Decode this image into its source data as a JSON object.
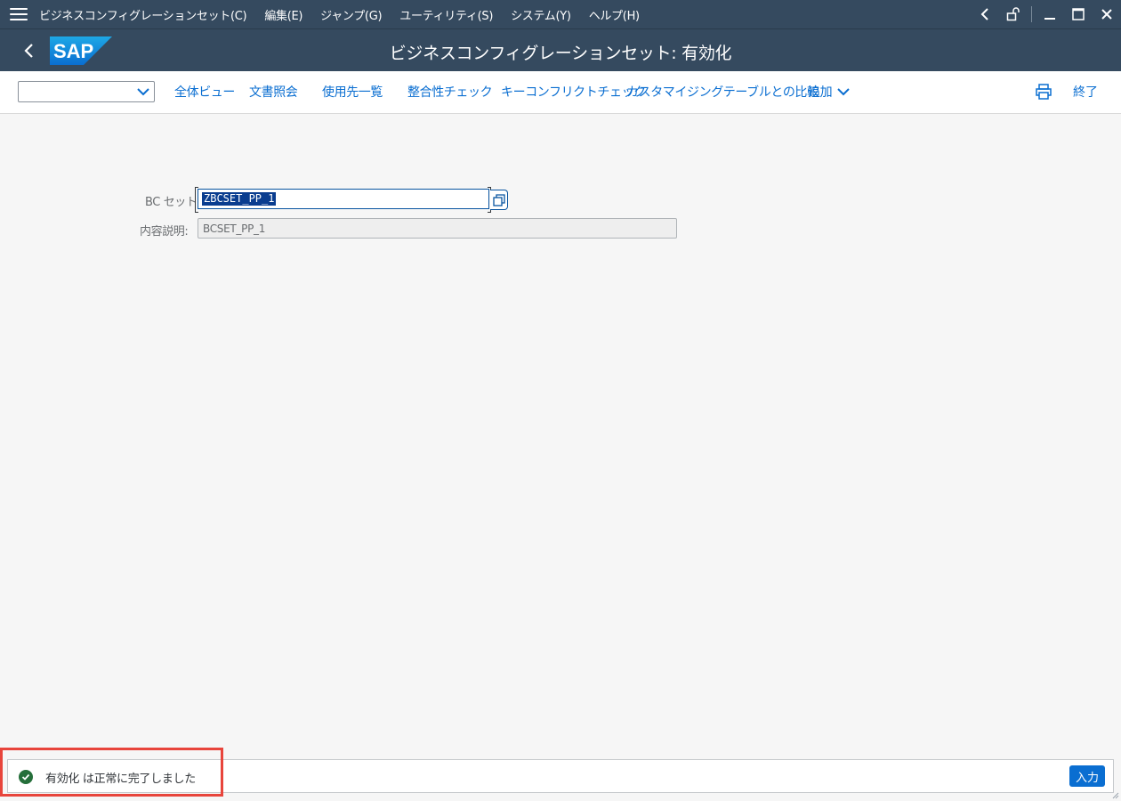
{
  "menu": {
    "items": [
      "ビジネスコンフィグレーションセット(C)",
      "編集(E)",
      "ジャンプ(G)",
      "ユーティリティ(S)",
      "システム(Y)",
      "ヘルプ(H)"
    ]
  },
  "window_controls": {
    "icons": [
      "chevron-left-icon",
      "unlock-icon",
      "minimize-icon",
      "maximize-icon",
      "close-icon"
    ]
  },
  "header": {
    "logo_text": "SAP",
    "title": "ビジネスコンフィグレーションセット: 有効化"
  },
  "toolbar": {
    "command_field_value": "",
    "buttons": [
      "全体ビュー",
      "文書照会",
      "使用先一覧",
      "整合性チェック",
      "キーコンフリクトチェック",
      "カスタマイジングテーブルとの比較",
      "追加"
    ],
    "exit_label": "終了"
  },
  "form": {
    "bc_set_label": "BC セット:",
    "bc_set_value": "ZBCSET_PP_1",
    "description_label": "内容説明:",
    "description_value": "BCSET_PP_1"
  },
  "status": {
    "message": "有効化 は正常に完了しました",
    "type": "success",
    "enter_label": "入力"
  },
  "colors": {
    "shell": "#354a5f",
    "link": "#0a6ed1",
    "success": "#256f3a",
    "highlight": "#e8453c"
  }
}
